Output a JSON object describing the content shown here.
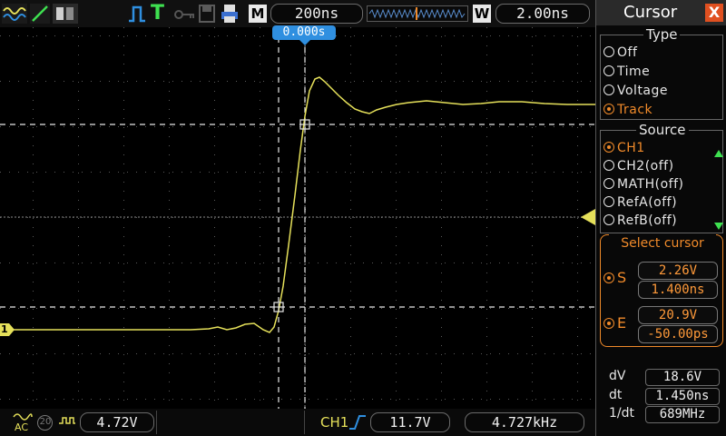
{
  "header": {
    "run_mode_symbol": "T",
    "m_label": "M",
    "timebase": "200ns",
    "w_label": "W",
    "window_timebase": "2.00ns",
    "trigger_time_marker": "0.000s"
  },
  "trace": {
    "channel_marker": "1",
    "color": "#e5e05a"
  },
  "footer": {
    "coupling": "AC",
    "bw_limit": "20",
    "ch1_scale": "4.72V",
    "trigger_source": "CH1",
    "trigger_level": "11.7V",
    "frequency": "4.727kHz"
  },
  "panel": {
    "title": "Cursor",
    "close_symbol": "X",
    "type_label": "Type",
    "type_options": [
      "Off",
      "Time",
      "Voltage",
      "Track"
    ],
    "type_selected": "Track",
    "source_label": "Source",
    "source_options": [
      "CH1",
      "CH2(off)",
      "MATH(off)",
      "RefA(off)",
      "RefB(off)"
    ],
    "source_selected": "CH1",
    "select_cursor_label": "Select cursor",
    "s_label": "S",
    "s_voltage": "2.26V",
    "s_time": "1.400ns",
    "e_label": "E",
    "e_voltage": "20.9V",
    "e_time": "-50.00ps",
    "dv_label": "dV",
    "dv_value": "18.6V",
    "dt_label": "dt",
    "dt_value": "1.450ns",
    "inv_dt_label": "1/dt",
    "inv_dt_value": "689MHz"
  },
  "colors": {
    "accent": "#f08a2a",
    "trace": "#e5e05a",
    "marker_blue": "#2f8fe0"
  }
}
